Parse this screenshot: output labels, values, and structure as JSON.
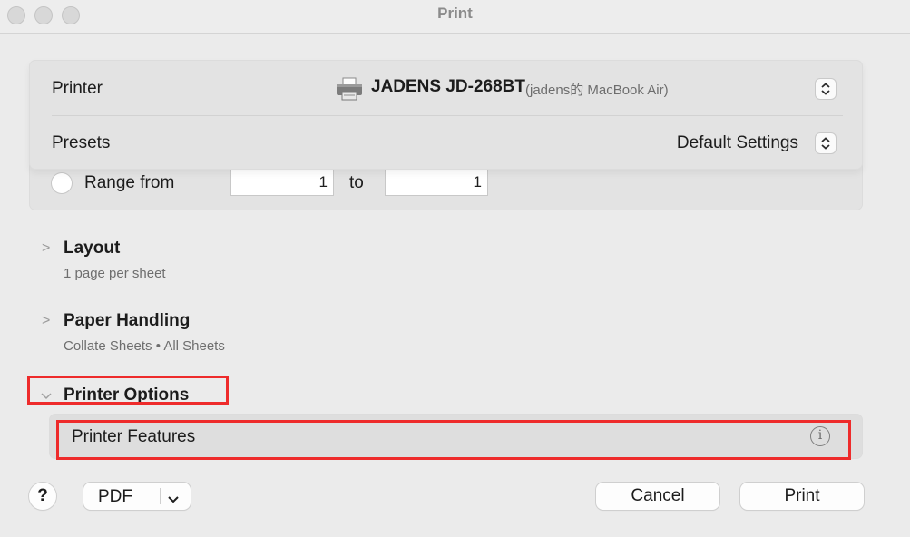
{
  "window": {
    "title": "Print"
  },
  "printer_panel": {
    "printer_label": "Printer",
    "printer_name": "JADENS JD-268BT",
    "printer_host": "(jadens的 MacBook Air)",
    "printer_icon": "printer-icon",
    "presets_label": "Presets",
    "presets_value": "Default Settings"
  },
  "range": {
    "label": "Range from",
    "to_label": "to",
    "from_value": "1",
    "to_value": "1"
  },
  "sections": {
    "layout": {
      "title": "Layout",
      "summary": "1 page per sheet"
    },
    "paper_handling": {
      "title": "Paper Handling",
      "summary": "Collate Sheets • All Sheets"
    },
    "printer_options": {
      "title": "Printer Options"
    },
    "printer_features": {
      "title": "Printer Features",
      "info_icon": "info-icon"
    }
  },
  "footer": {
    "help_label": "?",
    "pdf_label": "PDF",
    "cancel_label": "Cancel",
    "print_label": "Print"
  },
  "colors": {
    "highlight": "#ee2b2b",
    "background": "#ebebeb"
  }
}
